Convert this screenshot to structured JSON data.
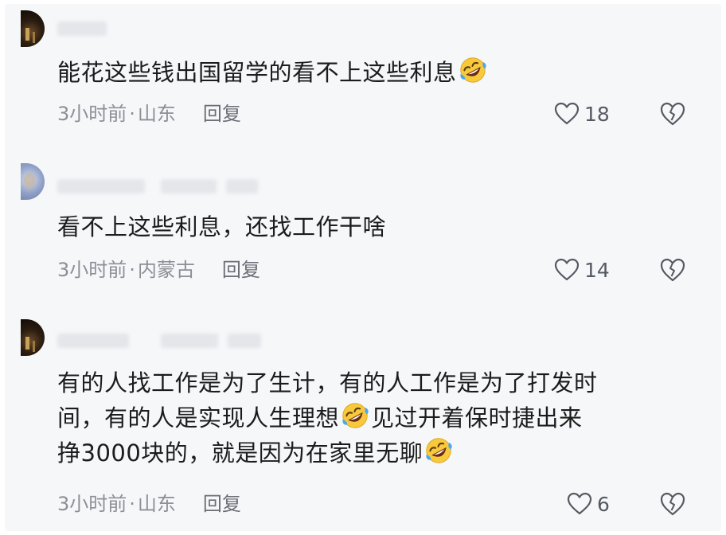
{
  "comments": [
    {
      "text_part1": "能花这些钱出国留学的看不上这些利息",
      "emoji": "rolling-on-floor-laughing-emoji",
      "time": "3小时前",
      "dot": "·",
      "location": "山东",
      "reply": "回复",
      "likes": "18"
    },
    {
      "text_part1": "看不上这些利息，还找工作干啥",
      "time": "3小时前",
      "dot": "·",
      "location": "内蒙古",
      "reply": "回复",
      "likes": "14"
    },
    {
      "line1": "有的人找工作是为了生计，有的人工作是为了打发时",
      "line2a": "间，有的人是实现人生理想",
      "line2b": "见过开着保时捷出来",
      "line3a": "挣3000块的，就是因为在家里无聊",
      "emoji": "rolling-on-floor-laughing-emoji",
      "time": "3小时前",
      "dot": "·",
      "location": "山东",
      "reply": "回复",
      "likes": "6"
    }
  ],
  "icons": {
    "like": "heart-outline-icon",
    "dislike": "broken-heart-outline-icon"
  },
  "colors": {
    "background": "#f6f7f9",
    "text": "#1c1c1c",
    "meta": "#8c8f96",
    "emoji_face": "#f9c93c",
    "emoji_tears": "#4aa8f0"
  }
}
